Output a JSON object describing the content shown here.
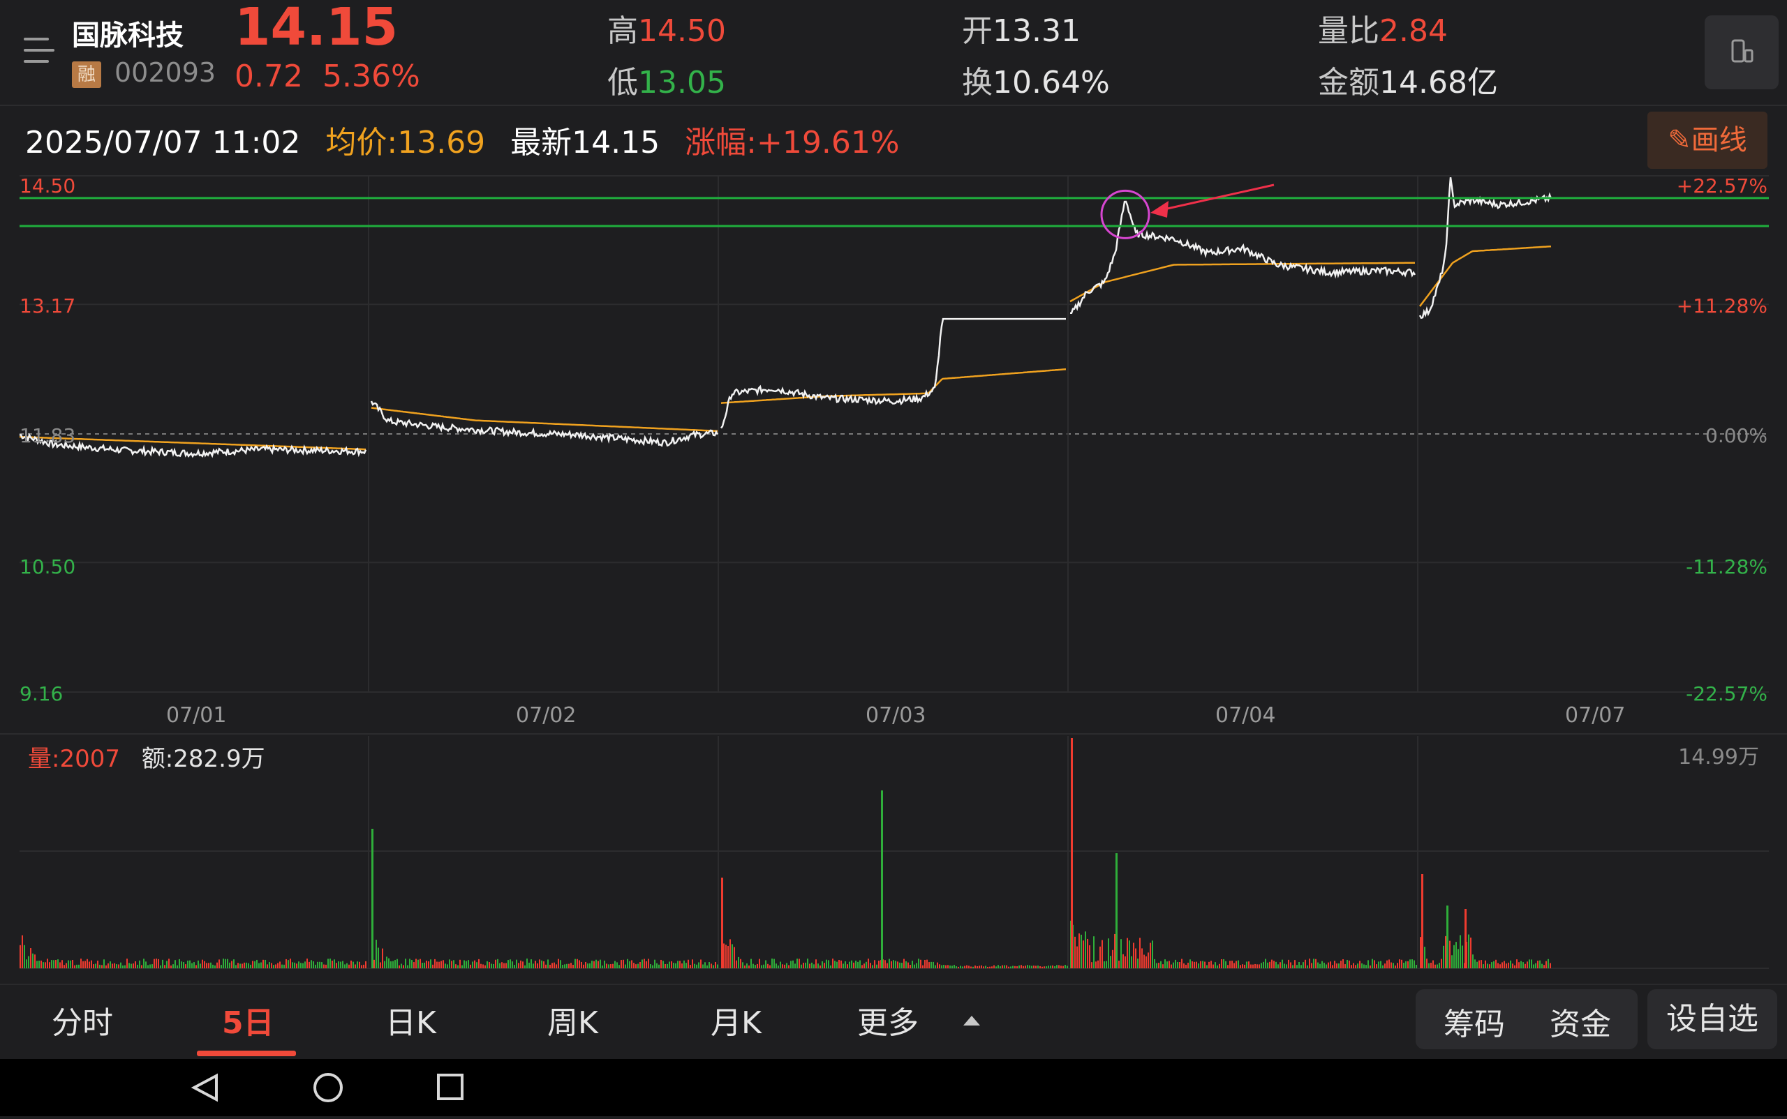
{
  "header": {
    "stock_name": "国脉科技",
    "margin_badge": "融",
    "stock_code": "002093",
    "price": "14.15",
    "change": "0.72",
    "change_pct": "5.36%",
    "high_label": "高",
    "high_value": "14.50",
    "low_label": "低",
    "low_value": "13.05",
    "open_label": "开",
    "open_value": "13.31",
    "turnover_label": "换",
    "turnover_value": "10.64%",
    "volume_ratio_label": "量比",
    "volume_ratio_value": "2.84",
    "amount_label": "金额",
    "amount_value": "14.68亿"
  },
  "info_bar": {
    "datetime": "2025/07/07 11:02",
    "avg_price": "均价:13.69",
    "latest": "最新14.15",
    "change": "涨幅:+19.61%",
    "draw_button": "画线"
  },
  "price_chart": {
    "left_axis": [
      "14.50",
      "13.17",
      "11.83",
      "10.50",
      "9.16"
    ],
    "right_axis": [
      "+22.57%",
      "+11.28%",
      "0.00%",
      "-11.28%",
      "-22.57%"
    ],
    "dates": [
      "07/01",
      "07/02",
      "07/03",
      "07/04",
      "07/07"
    ],
    "price_range": [
      9.16,
      14.5
    ],
    "prev_close": 11.83,
    "horizontal_lines": [
      14.27,
      13.98
    ],
    "colors": {
      "price_line": "#f2f2f2",
      "avg_line": "#f0a21f",
      "hline": "#1fae3d",
      "circle": "#d646d0",
      "arrow": "#f0304a",
      "up": "#ef3b2f",
      "down": "#2fae3a"
    }
  },
  "volume": {
    "volume_label": "量:2007",
    "amount_label": "额:282.9万",
    "max_label": "14.99万"
  },
  "tabs": [
    {
      "label": "分时"
    },
    {
      "label": "5日"
    },
    {
      "label": "日K"
    },
    {
      "label": "周K"
    },
    {
      "label": "月K"
    },
    {
      "label": "更多"
    }
  ],
  "right_buttons": {
    "chips": "筹码",
    "funds": "资金",
    "add_watch": "设自选"
  },
  "chart_data": {
    "type": "line",
    "categories": [
      "07/01",
      "07/02",
      "07/03",
      "07/04",
      "07/07"
    ],
    "series": [],
    "ylim": [
      9.16,
      14.5
    ],
    "title": ""
  }
}
